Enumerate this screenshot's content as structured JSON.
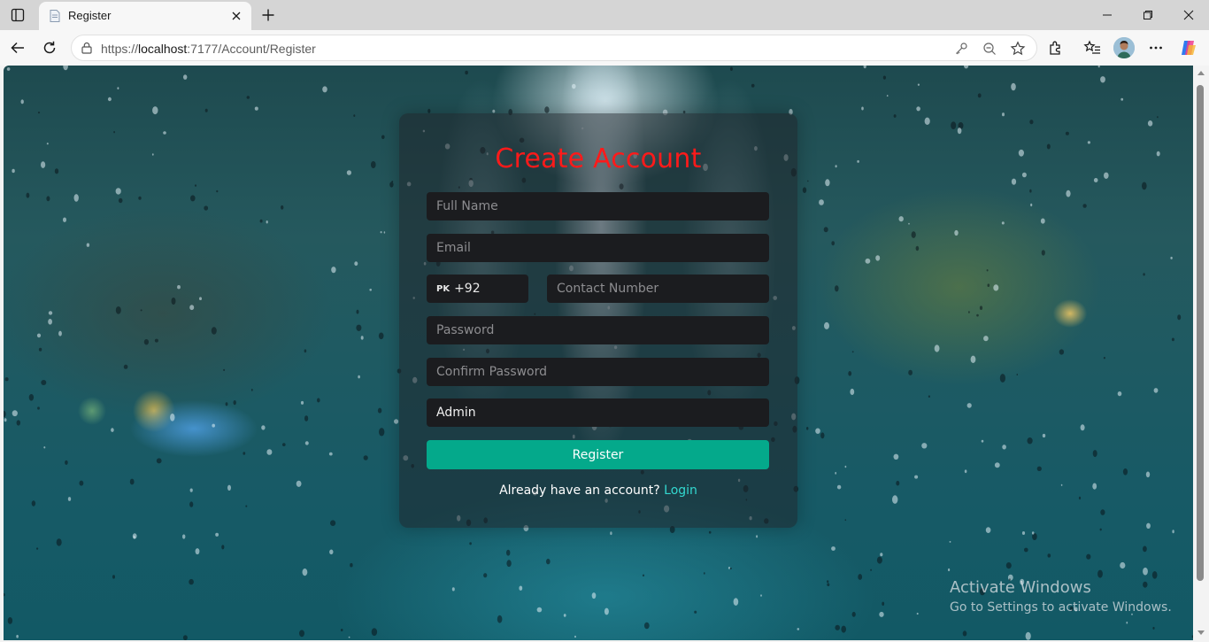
{
  "browser": {
    "tab_title": "Register",
    "url_prefix": "https://",
    "url_host": "localhost",
    "url_path": ":7177/Account/Register"
  },
  "page": {
    "title": "Create Account",
    "fields": {
      "full_name_placeholder": "Full Name",
      "email_placeholder": "Email",
      "country_flag": "PK",
      "country_code": "+92",
      "contact_placeholder": "Contact Number",
      "password_placeholder": "Password",
      "confirm_password_placeholder": "Confirm Password",
      "role_value": "Admin"
    },
    "register_label": "Register",
    "login_prompt": "Already have an account?",
    "login_link": "Login"
  },
  "watermark": {
    "title": "Activate Windows",
    "subtitle": "Go to Settings to activate Windows."
  },
  "colors": {
    "title_red": "#ff1a1a",
    "register_green": "#04a98b",
    "login_link": "#33d8d0"
  }
}
